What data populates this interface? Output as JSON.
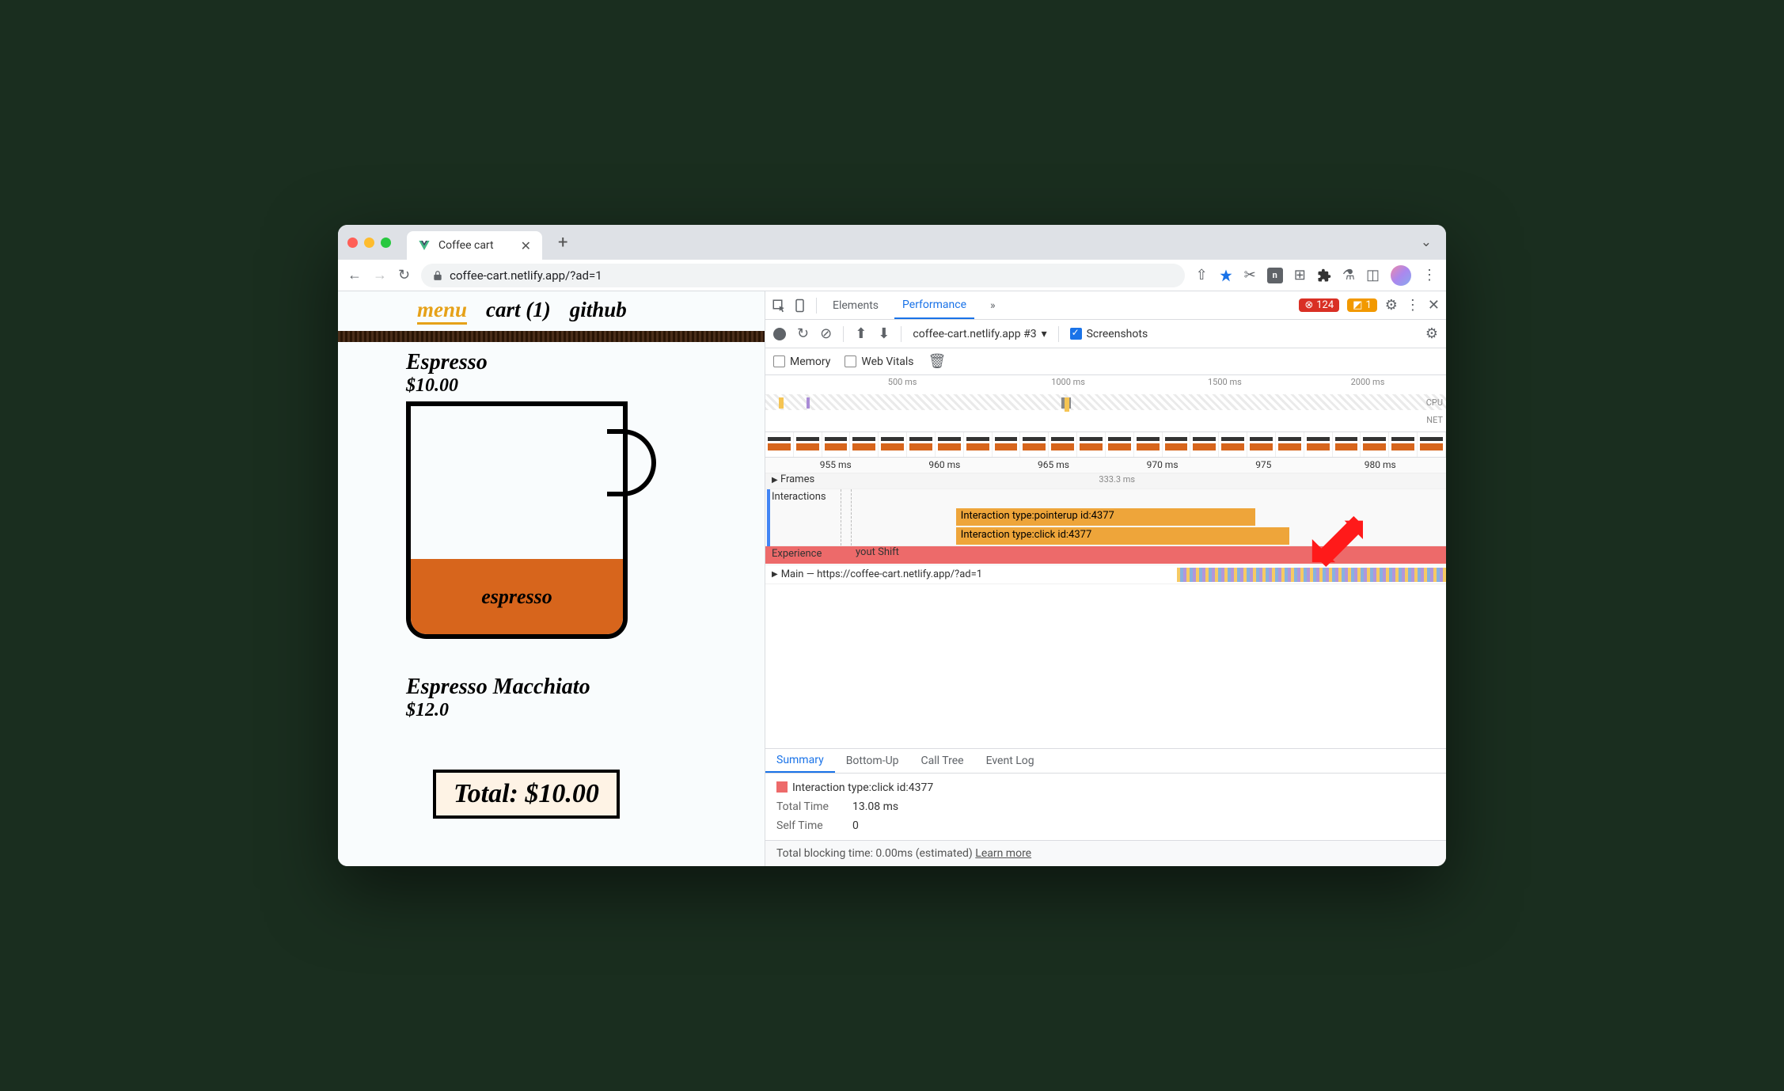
{
  "browser": {
    "tab_title": "Coffee cart",
    "url_display": "coffee-cart.netlify.app/?ad=1"
  },
  "page": {
    "nav": {
      "menu": "menu",
      "cart": "cart (1)",
      "github": "github"
    },
    "product1": {
      "name": "Espresso",
      "price": "$10.00",
      "fill_label": "espresso"
    },
    "product2": {
      "name": "Espresso Macchiato",
      "price": "$12.0"
    },
    "total_label": "Total: $10.00"
  },
  "devtools": {
    "tabs": {
      "elements": "Elements",
      "performance": "Performance",
      "more": "»"
    },
    "badges": {
      "errors": "124",
      "warnings": "1"
    },
    "toolbar": {
      "recording_name": "coffee-cart.netlify.app #3",
      "screenshots_label": "Screenshots",
      "memory_label": "Memory",
      "web_vitals_label": "Web Vitals"
    },
    "overview": {
      "ticks": [
        "500 ms",
        "1000 ms",
        "1500 ms",
        "2000 ms"
      ],
      "cpu_label": "CPU",
      "net_label": "NET"
    },
    "timeline": {
      "ticks": [
        "955 ms",
        "960 ms",
        "965 ms",
        "970 ms",
        "975",
        "980 ms"
      ],
      "frames_label": "Frames",
      "frames_time": "333.3 ms",
      "interactions_label": "Interactions",
      "interaction1": "Interaction type:pointerup id:4377",
      "interaction2": "Interaction type:click id:4377",
      "experience_label": "Experience",
      "layout_shift": "yout Shift",
      "main_label": "Main — https://coffee-cart.netlify.app/?ad=1"
    },
    "bottom_tabs": {
      "summary": "Summary",
      "bottom_up": "Bottom-Up",
      "call_tree": "Call Tree",
      "event_log": "Event Log"
    },
    "summary": {
      "title": "Interaction type:click id:4377",
      "total_time_k": "Total Time",
      "total_time_v": "13.08 ms",
      "self_time_k": "Self Time",
      "self_time_v": "0"
    },
    "footer": {
      "text": "Total blocking time: 0.00ms (estimated)",
      "learn": "Learn more"
    }
  }
}
